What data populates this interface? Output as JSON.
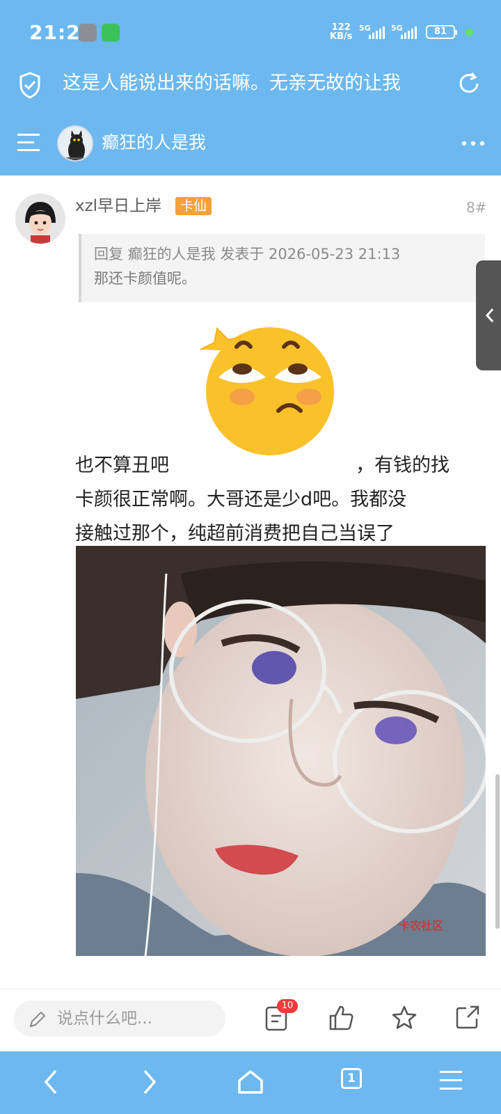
{
  "status": {
    "time": "21:21",
    "net_speed_value": "122",
    "net_speed_unit": "KB/s",
    "sig1": "5G",
    "sig2": "5G",
    "battery": "81"
  },
  "browser": {
    "page_title": "这是人能说出来的话嘛。无亲无故的让我",
    "tab_count": "1"
  },
  "thread": {
    "author": "癫狂的人是我"
  },
  "post": {
    "username": "xzl早日上岸",
    "badge": "卡仙",
    "floor": "8#",
    "quote_meta": "回复 癫狂的人是我 发表于 2026-05-23 21:13",
    "quote_text": "那还卡颜值呢。",
    "text_line1_a": "也不算丑吧",
    "text_line1_b": "，有钱的找",
    "text_line2": "卡颜很正常啊。大哥还是少d吧。我都没",
    "text_line3": "接触过那个，纯超前消费把自己当误了",
    "watermark": "卡农社区"
  },
  "actions": {
    "comment_placeholder": "说点什么吧...",
    "comment_count": "10"
  },
  "colors": {
    "brand": "#6cb8ef",
    "badge": "#f4a13a",
    "notify": "#ef3a3a"
  }
}
